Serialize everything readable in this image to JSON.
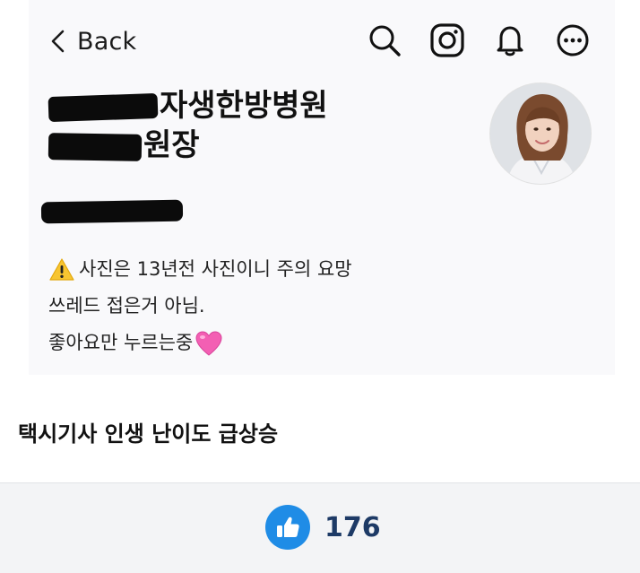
{
  "profile_screenshot": {
    "back_label": "Back",
    "top_icons": [
      "search-icon",
      "instagram-icon",
      "bell-icon",
      "more-icon"
    ],
    "name_line1_visible": "자생한방병원",
    "name_line2_visible": "원장",
    "bio": {
      "line1": "사진은 13년전 사진이니 주의 요망",
      "line2": "쓰레드 접은거 아님.",
      "line3": "좋아요만 누르는중"
    },
    "warning_emoji": "warning-icon",
    "heart_emoji": "pink-heart-icon"
  },
  "post": {
    "title": "택시기사 인생 난이도 급상승"
  },
  "footer": {
    "like_count": "176",
    "like_color": "#1f8ce6"
  }
}
